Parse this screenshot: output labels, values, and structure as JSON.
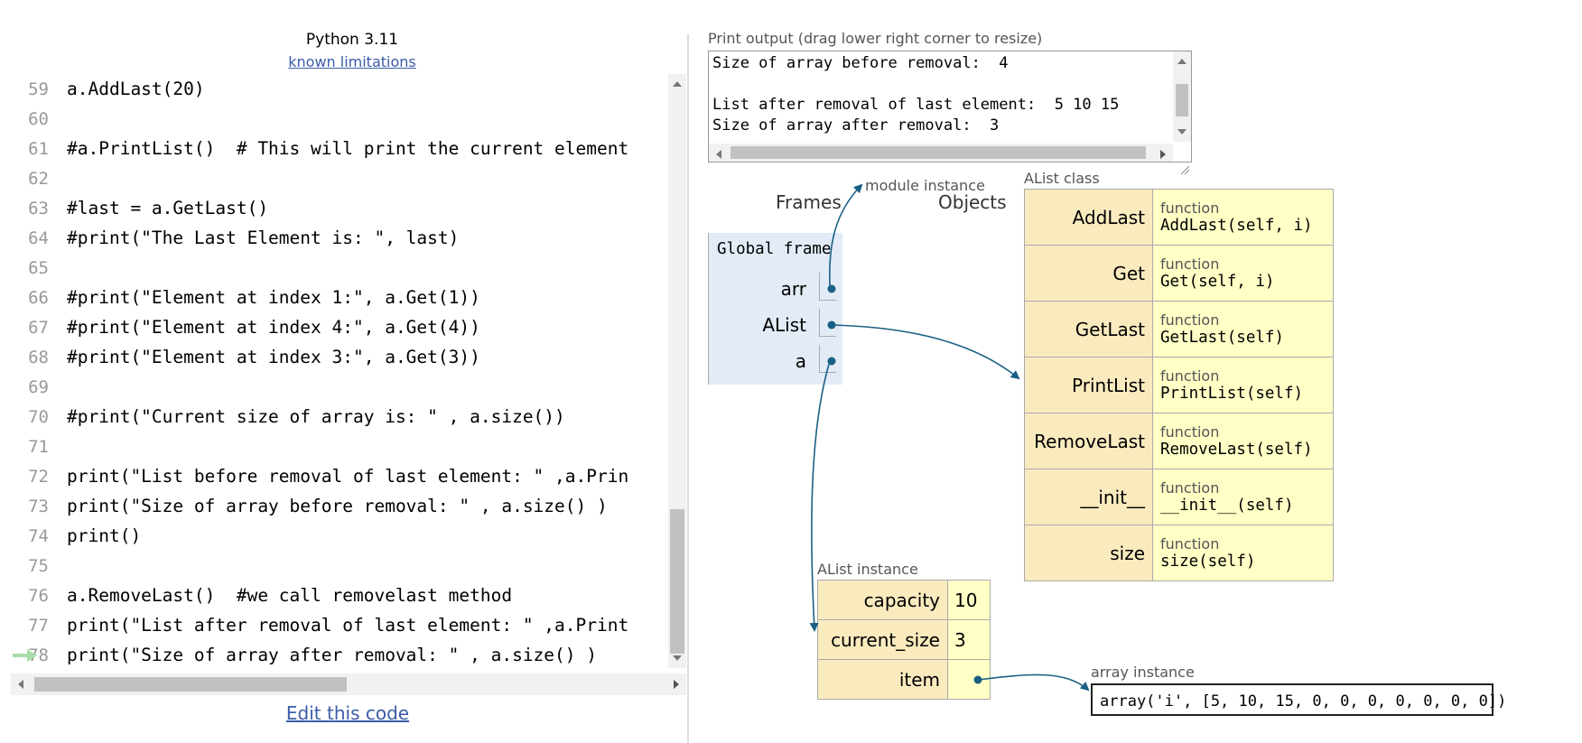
{
  "header": {
    "language": "Python 3.11",
    "limitations_link": "known limitations"
  },
  "code": {
    "lines": [
      {
        "n": "59",
        "text": "a.AddLast(20)"
      },
      {
        "n": "60",
        "text": ""
      },
      {
        "n": "61",
        "text": "#a.PrintList()  # This will print the current element"
      },
      {
        "n": "62",
        "text": ""
      },
      {
        "n": "63",
        "text": "#last = a.GetLast()"
      },
      {
        "n": "64",
        "text": "#print(\"The Last Element is: \", last)"
      },
      {
        "n": "65",
        "text": ""
      },
      {
        "n": "66",
        "text": "#print(\"Element at index 1:\", a.Get(1))"
      },
      {
        "n": "67",
        "text": "#print(\"Element at index 4:\", a.Get(4))"
      },
      {
        "n": "68",
        "text": "#print(\"Element at index 3:\", a.Get(3))"
      },
      {
        "n": "69",
        "text": ""
      },
      {
        "n": "70",
        "text": "#print(\"Current size of array is: \" , a.size())"
      },
      {
        "n": "71",
        "text": ""
      },
      {
        "n": "72",
        "text": "print(\"List before removal of last element: \" ,a.Prin"
      },
      {
        "n": "73",
        "text": "print(\"Size of array before removal: \" , a.size() )"
      },
      {
        "n": "74",
        "text": "print()"
      },
      {
        "n": "75",
        "text": ""
      },
      {
        "n": "76",
        "text": "a.RemoveLast()  #we call removelast method"
      },
      {
        "n": "77",
        "text": "print(\"List after removal of last element: \" ,a.Print"
      },
      {
        "n": "78",
        "text": "print(\"Size of array after removal: \" , a.size() )"
      }
    ],
    "current_line": "78",
    "edit_link": "Edit this code"
  },
  "output": {
    "label": "Print output (drag lower right corner to resize)",
    "text": "Size of array before removal:  4\n\nList after removal of last element:  5 10 15\nSize of array after removal:  3"
  },
  "viz": {
    "frames_header": "Frames",
    "objects_header": "Objects",
    "module_label": "module instance",
    "global_frame": {
      "title": "Global frame",
      "vars": [
        "arr",
        "AList",
        "a"
      ]
    },
    "class_obj": {
      "label": "AList class",
      "methods": [
        {
          "name": "AddLast",
          "kind": "function",
          "sig": "AddLast(self, i)"
        },
        {
          "name": "Get",
          "kind": "function",
          "sig": "Get(self, i)"
        },
        {
          "name": "GetLast",
          "kind": "function",
          "sig": "GetLast(self)"
        },
        {
          "name": "PrintList",
          "kind": "function",
          "sig": "PrintList(self)"
        },
        {
          "name": "RemoveLast",
          "kind": "function",
          "sig": "RemoveLast(self)"
        },
        {
          "name": "__init__",
          "kind": "function",
          "sig": "__init__(self)"
        },
        {
          "name": "size",
          "kind": "function",
          "sig": "size(self)"
        }
      ]
    },
    "instance": {
      "label": "AList instance",
      "fields": [
        {
          "name": "capacity",
          "value": "10"
        },
        {
          "name": "current_size",
          "value": "3"
        },
        {
          "name": "item",
          "value": ""
        }
      ]
    },
    "array_obj": {
      "label": "array instance",
      "repr": "array('i', [5, 10, 15, 0, 0, 0, 0, 0, 0, 0])"
    },
    "arrow_color": "#1a5f85"
  }
}
